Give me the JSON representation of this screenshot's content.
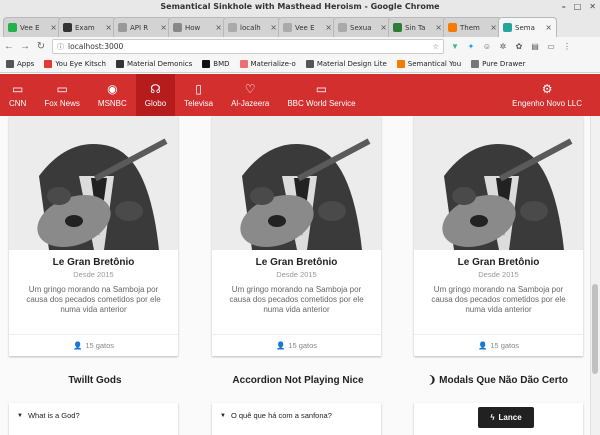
{
  "window": {
    "title": "Semantical Sinkhole with Masthead Heroism - Google Chrome"
  },
  "tabs": [
    {
      "label": "Vee E",
      "color": "#22b14c"
    },
    {
      "label": "Exam",
      "color": "#333333"
    },
    {
      "label": "API R",
      "color": "#999999"
    },
    {
      "label": "How",
      "color": "#888888"
    },
    {
      "label": "localh",
      "color": "#aaaaaa"
    },
    {
      "label": "Vee E",
      "color": "#aaaaaa"
    },
    {
      "label": "Sexua",
      "color": "#aaaaaa"
    },
    {
      "label": "Sin Ta",
      "color": "#2e7d32"
    },
    {
      "label": "Them",
      "color": "#f57c00"
    },
    {
      "label": "Sema",
      "color": "#26a69a"
    }
  ],
  "address": {
    "url": "localhost:3000"
  },
  "bookmarks": [
    {
      "label": "Apps",
      "color": "#555555"
    },
    {
      "label": "You Eye Kitsch",
      "color": "#e53935"
    },
    {
      "label": "Material Demonics",
      "color": "#333333"
    },
    {
      "label": "BMD",
      "color": "#111111"
    },
    {
      "label": "Materialize-o",
      "color": "#ee6e73"
    },
    {
      "label": "Material Design Lite",
      "color": "#555555"
    },
    {
      "label": "Semantical You",
      "color": "#f57c00"
    },
    {
      "label": "Pure Drawer",
      "color": "#777777"
    }
  ],
  "nav": {
    "items": [
      {
        "label": "CNN",
        "icon": "tv-icon",
        "glyph": "▭"
      },
      {
        "label": "Fox News",
        "icon": "tv-icon",
        "glyph": "▭"
      },
      {
        "label": "MSNBC",
        "icon": "podcast-icon",
        "glyph": "◉"
      },
      {
        "label": "Globo",
        "icon": "headphones-icon",
        "glyph": "☊"
      },
      {
        "label": "Televisa",
        "icon": "tablet-icon",
        "glyph": "▯"
      },
      {
        "label": "Al-Jazeera",
        "icon": "heartbeat-icon",
        "glyph": "♡"
      },
      {
        "label": "BBC World Service",
        "icon": "tv-icon",
        "glyph": "▭"
      }
    ],
    "active_index": 3,
    "brand": {
      "label": "Engenho Novo LLC",
      "icon": "gears-icon",
      "glyph": "⚙"
    }
  },
  "cards": [
    {
      "title": "Le Gran Bretônio",
      "subtitle": "Desde 2015",
      "description": "Um gringo morando na Samboja por causa dos pecados cometidos por ele numa vida anterior",
      "footer": "15 gatos"
    },
    {
      "title": "Le Gran Bretônio",
      "subtitle": "Desde 2015",
      "description": "Um gringo morando na Samboja por causa dos pecados cometidos por ele numa vida anterior",
      "footer": "15 gatos"
    },
    {
      "title": "Le Gran Bretônio",
      "subtitle": "Desde 2015",
      "description": "Um gringo morando na Samboja por causa dos pecados cometidos por ele numa vida anterior",
      "footer": "15 gatos"
    }
  ],
  "sections": [
    {
      "title": "Twillt Gods",
      "item": "What is a God?"
    },
    {
      "title": "Accordion Not Playing Nice",
      "item": "O quê que há com a sanfona?"
    },
    {
      "title": "Modals Que Não Dão Certo",
      "button": "Lance"
    }
  ],
  "colors": {
    "accent": "#d32f2f",
    "accent_active": "#b71c1c"
  }
}
